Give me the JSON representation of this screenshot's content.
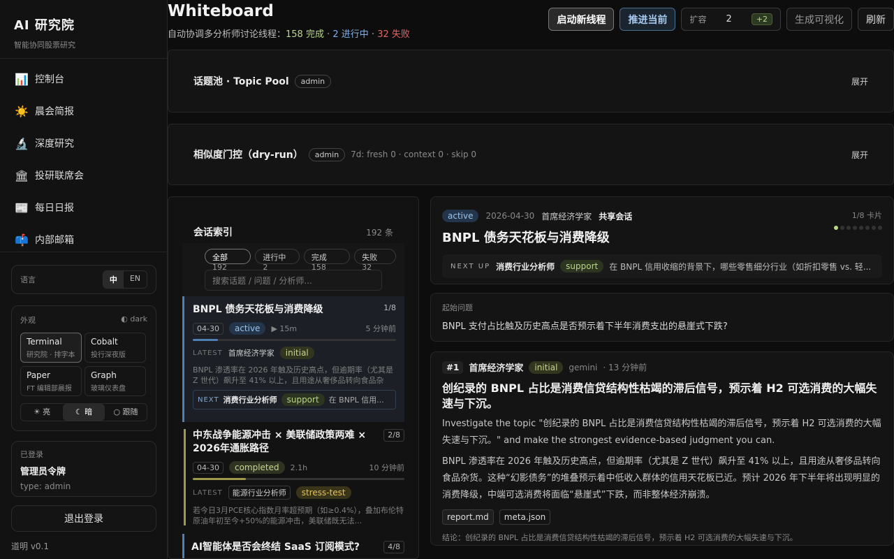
{
  "brand": {
    "title": "AI 研究院",
    "subtitle": "智能协同股票研究"
  },
  "nav": [
    {
      "icon": "📊",
      "icon_name": "chart-icon",
      "label": "控制台"
    },
    {
      "icon": "☀️",
      "icon_name": "sun-icon",
      "label": "晨会简报"
    },
    {
      "icon": "🔬",
      "icon_name": "microscope-icon",
      "label": "深度研究"
    },
    {
      "icon": "🏛",
      "icon_name": "bank-icon",
      "label": "投研联席会"
    },
    {
      "icon": "📰",
      "icon_name": "newspaper-icon",
      "label": "每日日报"
    },
    {
      "icon": "📫",
      "icon_name": "mailbox-icon",
      "label": "内部邮箱"
    }
  ],
  "settings": {
    "language_label": "语言",
    "lang_zh": "中",
    "lang_en": "EN",
    "appearance_label": "外观",
    "appearance_mode": "◐ dark",
    "themes": [
      {
        "name": "Terminal",
        "desc": "研究院 · 排字本"
      },
      {
        "name": "Cobalt",
        "desc": "投行深夜版"
      },
      {
        "name": "Paper",
        "desc": "FT 编辑部晨报"
      },
      {
        "name": "Graph",
        "desc": "玻璃仪表盘"
      }
    ],
    "mode_light": "☀ 亮",
    "mode_dark": "☾ 暗",
    "mode_follow": "○ 跟随"
  },
  "login": {
    "label": "已登录",
    "name": "管理员令牌",
    "type": "type: admin"
  },
  "logout": "退出登录",
  "version": "道明 v0.1",
  "header": {
    "title": "Whiteboard",
    "subtitle_prefix": "自动协调多分析师讨论线程：",
    "completed": "158 完成",
    "in_progress": "2 进行中",
    "failed": "32 失败",
    "sep": " · ",
    "btn_start": "启动新线程",
    "btn_advance": "推进当前",
    "scale_label": "扩容",
    "scale_value": "2",
    "scale_plus": "+2",
    "btn_visualize": "生成可视化",
    "btn_refresh": "刷新"
  },
  "topic_pool": {
    "title": "话题池 · Topic Pool",
    "badge": "admin",
    "expand": "展开"
  },
  "gate": {
    "title": "相似度门控（dry-run）",
    "badge": "admin",
    "stats": "7d: fresh 0 · context 0 · skip 0",
    "expand": "展开"
  },
  "session_index": {
    "title": "会话索引",
    "count": "192 条",
    "filters": [
      {
        "label": "全部",
        "count": "192"
      },
      {
        "label": "进行中",
        "count": "2"
      },
      {
        "label": "完成",
        "count": "158"
      },
      {
        "label": "失败",
        "count": "32"
      }
    ],
    "search_placeholder": "搜索话题 / 问题 / 分析师...",
    "items": [
      {
        "title": "BNPL 债务天花板与消费降级",
        "progress": "1/8",
        "date": "04-30",
        "status": "active",
        "duration": "▶ 15m",
        "ago": "5 分钟前",
        "progress_ratio": 0.125,
        "latest_label": "LATEST",
        "latest_who": "首席经济学家",
        "latest_tag": "initial",
        "snippet": "BNPL 渗透率在 2026 年触及历史高点，但逾期率（尤其是 Z 世代）飙升至 41% 以上，且用途从奢侈品转向食品杂货...",
        "next_label": "NEXT",
        "next_who": "消费行业分析师",
        "next_tag": "support",
        "next_text": "在 BNPL 信用..."
      },
      {
        "title": "中东战争能源冲击 × 美联储政策两难 × 2026年通胀路径",
        "progress": "2/8",
        "date": "04-30",
        "status": "completed",
        "duration": "2.1h",
        "ago": "10 分钟前",
        "progress_ratio": 0.25,
        "latest_label": "LATEST",
        "latest_who": "能源行业分析师",
        "latest_tag": "stress-test",
        "snippet": "若今日3月PCE核心指数月率超预期（如≥0.4%），叠加布伦特原油年初至今+50%的能源冲击，美联储既无法..."
      },
      {
        "title": "AI智能体是否会终结 SaaS 订阅模式?",
        "progress": "4/8"
      }
    ]
  },
  "detail": {
    "status": "active",
    "date": "2026-04-30",
    "author": "首席经济学家",
    "shared": "共享会话",
    "cards": "1/8 卡片",
    "dots_total": 8,
    "dots_active": 1,
    "title": "BNPL 债务天花板与消费降级",
    "next_label": "NEXT UP",
    "next_who": "消费行业分析师",
    "next_tag": "support",
    "next_text": "在 BNPL 信用收缩的背景下，哪些零售细分行业（如折扣零售 vs. 轻...",
    "question_label": "起始问题",
    "question": "BNPL 支付占比触及历史高点是否预示着下半年消费支出的悬崖式下跌?",
    "msg": {
      "num": "#1",
      "author": "首席经济学家",
      "tag": "initial",
      "model": "gemini",
      "ago": "· 13 分钟前",
      "title": "创纪录的 BNPL 占比是消费信贷结构性枯竭的滞后信号，预示着 H2 可选消费的大幅失速与下沉。",
      "body1": "Investigate the topic \"创纪录的 BNPL 占比是消费信贷结构性枯竭的滞后信号，预示着 H2 可选消费的大幅失速与下沉。\" and make the strongest evidence-based judgment you can.",
      "body2": "BNPL 渗透率在 2026 年触及历史高点，但逾期率（尤其是 Z 世代）飙升至 41% 以上，且用途从奢侈品转向食品杂货。这种“幻影债务”的堆叠预示着中低收入群体的信用天花板已近。预计 2026 年下半年将出现明显的消费降级，中端可选消费将面临“悬崖式”下跌，而非整体经济崩溃。",
      "file1": "report.md",
      "file2": "meta.json",
      "conclusion": "结论：创纪录的 BNPL 占比是消费信贷结构性枯竭的滞后信号，预示着 H2 可选消费的大幅失速与下沉。"
    }
  }
}
